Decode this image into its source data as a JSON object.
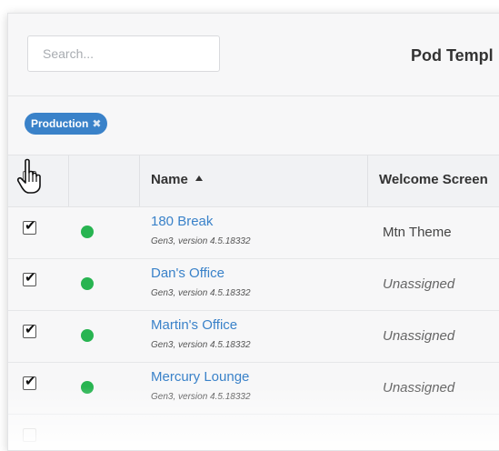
{
  "search": {
    "placeholder": "Search..."
  },
  "header": {
    "title": "Pod Templ"
  },
  "filters": [
    {
      "label": "Production",
      "remove_icon": "close-icon"
    }
  ],
  "table": {
    "columns": {
      "name": "Name",
      "welcome": "Welcome Screen"
    },
    "sort": {
      "column": "name",
      "direction": "ascending"
    },
    "select_all_checked": true,
    "rows": [
      {
        "checked": true,
        "status_color": "#28b451",
        "name": "180 Break",
        "sub": "Gen3, version 4.5.18332",
        "welcome": "Mtn Theme",
        "welcome_italic": false
      },
      {
        "checked": true,
        "status_color": "#28b451",
        "name": "Dan's Office",
        "sub": "Gen3, version 4.5.18332",
        "welcome": "Unassigned",
        "welcome_italic": true
      },
      {
        "checked": true,
        "status_color": "#28b451",
        "name": "Martin's Office",
        "sub": "Gen3, version 4.5.18332",
        "welcome": "Unassigned",
        "welcome_italic": true
      },
      {
        "checked": true,
        "status_color": "#28b451",
        "name": "Mercury Lounge",
        "sub": "Gen3, version 4.5.18332",
        "welcome": "Unassigned",
        "welcome_italic": true
      }
    ]
  },
  "colors": {
    "accent": "#3a82c9",
    "status_online": "#28b451"
  }
}
